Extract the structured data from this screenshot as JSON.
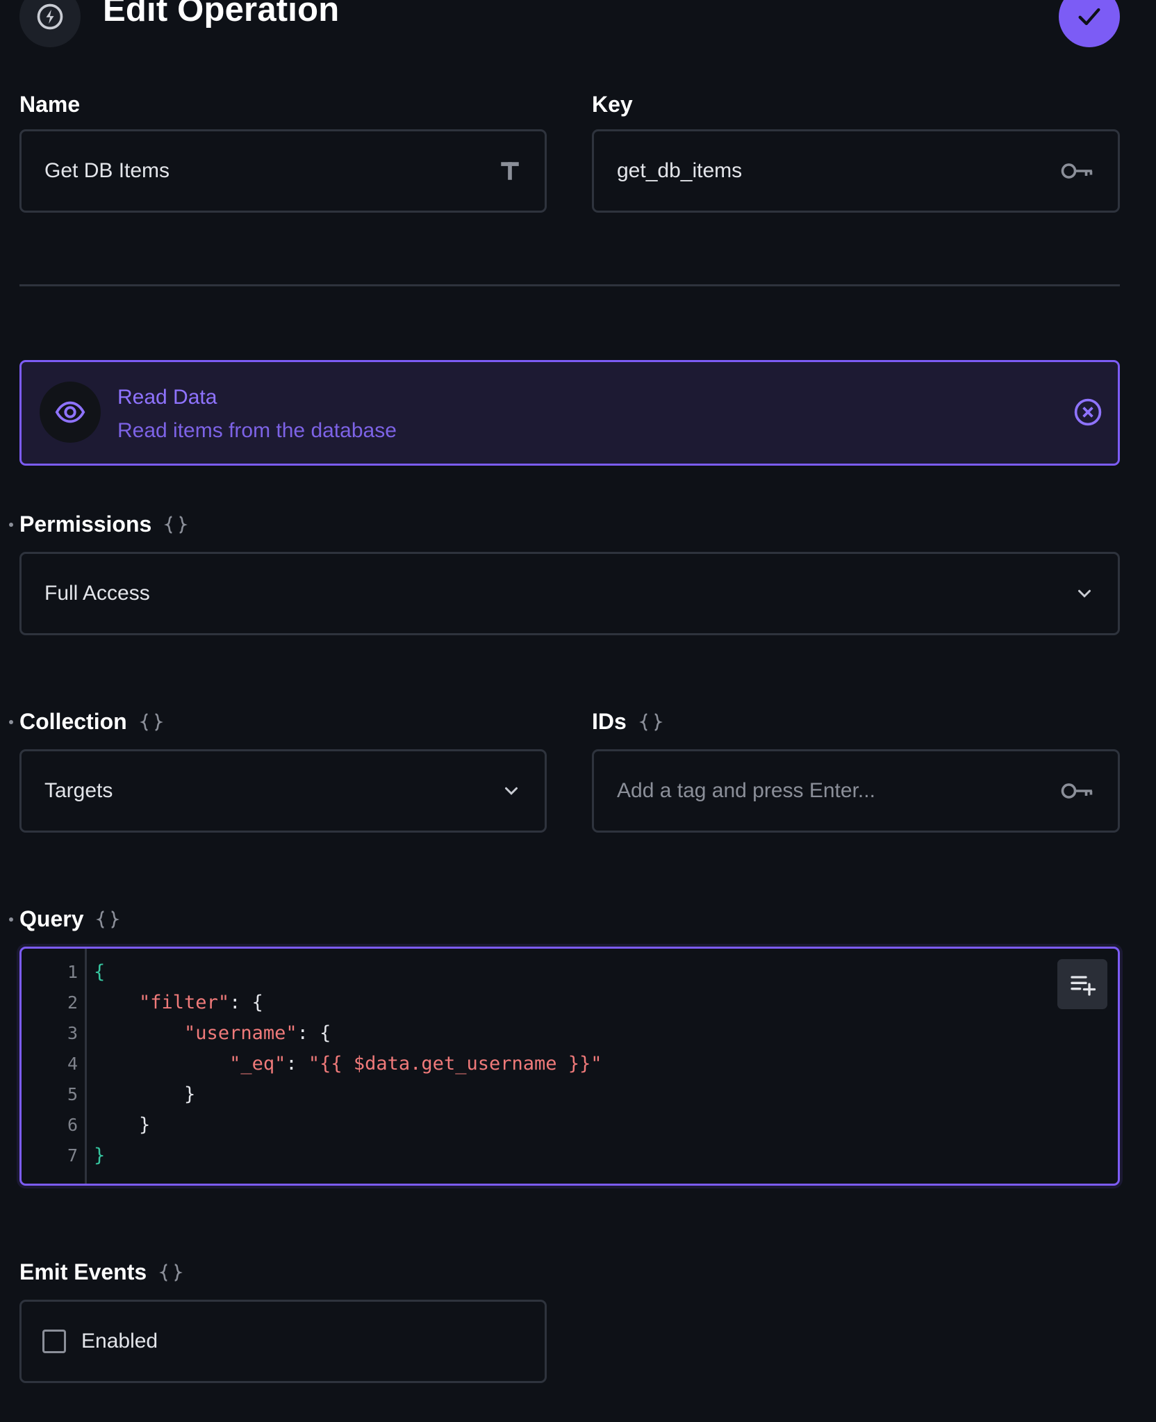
{
  "header": {
    "title": "Edit Operation",
    "icon": "bolt-icon",
    "save_icon": "check-icon"
  },
  "colors": {
    "background": "#0e1117",
    "accent": "#7c5cf5",
    "border": "#2e333d",
    "text": "#ffffff"
  },
  "name_field": {
    "label": "Name",
    "value": "Get DB Items",
    "icon": "text-type-icon"
  },
  "key_field": {
    "label": "Key",
    "value": "get_db_items",
    "icon": "key-icon"
  },
  "operation": {
    "title": "Read Data",
    "description": "Read items from the database",
    "icon": "eye-icon",
    "remove_icon": "close-circle-icon"
  },
  "permissions": {
    "label": "Permissions",
    "value": "Full Access"
  },
  "collection": {
    "label": "Collection",
    "value": "Targets"
  },
  "ids": {
    "label": "IDs",
    "placeholder": "Add a tag and press Enter..."
  },
  "query": {
    "label": "Query",
    "line_numbers": [
      "1",
      "2",
      "3",
      "4",
      "5",
      "6",
      "7"
    ],
    "lines": [
      {
        "indent": "",
        "parts": [
          "{"
        ]
      },
      {
        "indent": "    ",
        "parts": [
          "\"filter\"",
          ": {"
        ]
      },
      {
        "indent": "        ",
        "parts": [
          "\"username\"",
          ": {"
        ]
      },
      {
        "indent": "            ",
        "parts": [
          "\"_eq\"",
          ": ",
          "\"{{ $data.get_username }}\""
        ]
      },
      {
        "indent": "        ",
        "parts": [
          "}"
        ]
      },
      {
        "indent": "    ",
        "parts": [
          "}"
        ]
      },
      {
        "indent": "",
        "parts": [
          "}"
        ]
      }
    ]
  },
  "emit_events": {
    "label": "Emit Events",
    "checkbox_label": "Enabled",
    "checked": false
  }
}
